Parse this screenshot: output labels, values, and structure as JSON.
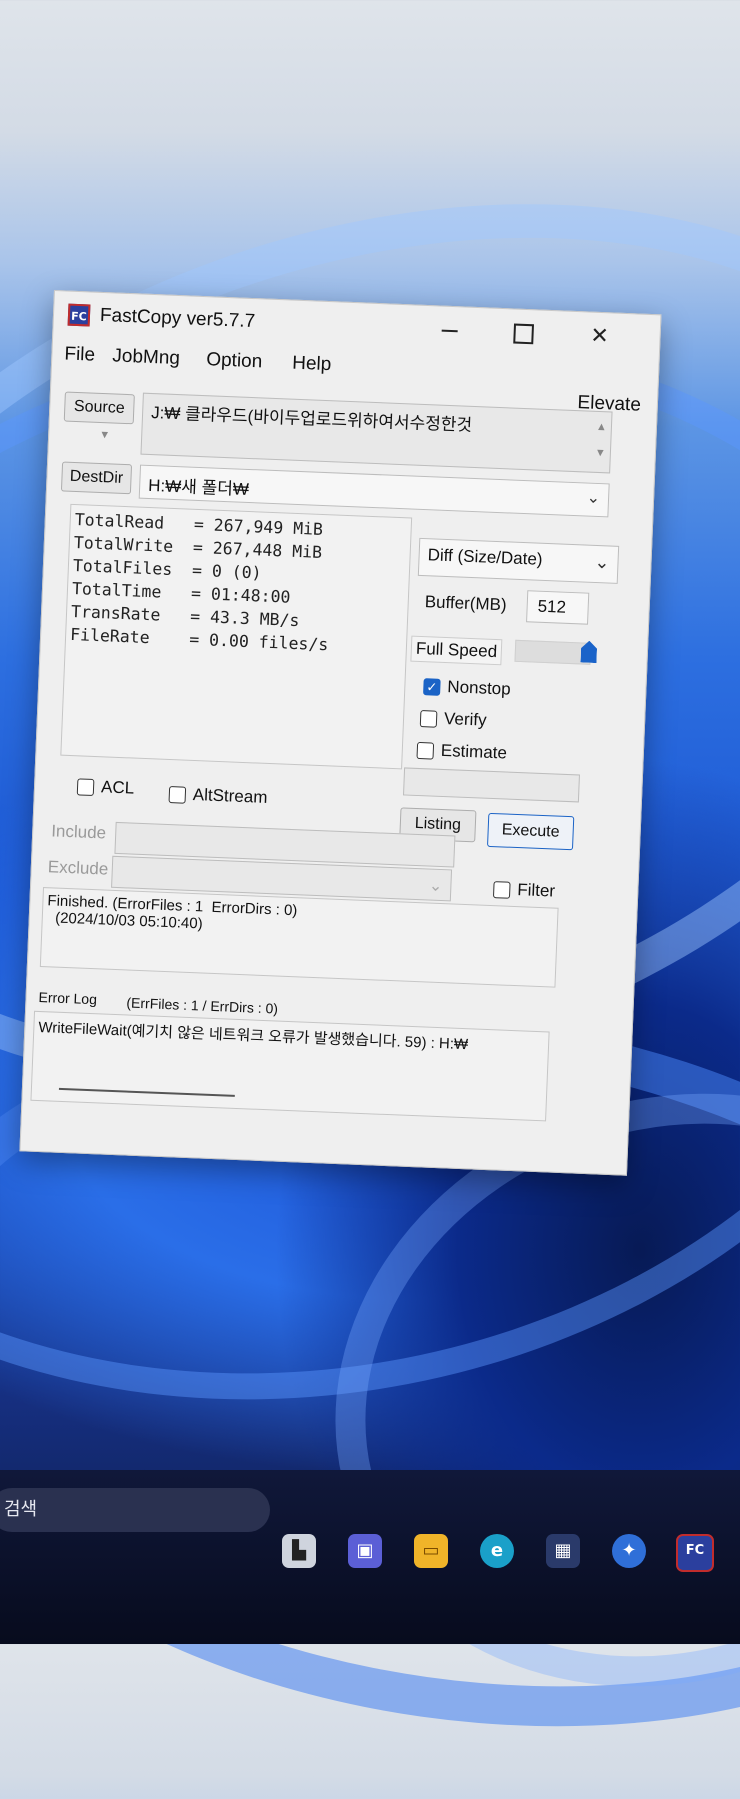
{
  "window": {
    "title": "FastCopy ver5.7.7",
    "icon_text": "FC",
    "buttons": {
      "minimize": "",
      "maximize": "",
      "close": "✕"
    }
  },
  "menu": [
    "File",
    "JobMng",
    "Option",
    "Help"
  ],
  "elevate": "Elevate",
  "source": {
    "button_label": "Source",
    "path": "J:₩        클라우드(바이두업로드위하여서수정한것"
  },
  "dest": {
    "button_label": "DestDir",
    "path": "H:₩새 폴더₩"
  },
  "stats": [
    "TotalRead   = 267,949 MiB",
    "TotalWrite  = 267,448 MiB",
    "TotalFiles  = 0 (0)",
    "TotalTime   = 01:48:00",
    "TransRate   = 43.3 MB/s",
    "FileRate    = 0.00 files/s"
  ],
  "mode": {
    "selected": "Diff (Size/Date)"
  },
  "buffer": {
    "label": "Buffer(MB)",
    "value": "512"
  },
  "speed": {
    "label": "Full Speed",
    "level": 1.0
  },
  "options": {
    "nonstop": {
      "label": "Nonstop",
      "checked": true
    },
    "verify": {
      "label": "Verify",
      "checked": false
    },
    "estimate": {
      "label": "Estimate",
      "checked": false
    },
    "acl": {
      "label": "ACL",
      "checked": false
    },
    "altstream": {
      "label": "AltStream",
      "checked": false
    },
    "filter": {
      "label": "Filter",
      "checked": false
    }
  },
  "actions": {
    "listing": "Listing",
    "execute": "Execute"
  },
  "filters": {
    "include_label": "Include",
    "exclude_label": "Exclude"
  },
  "status": {
    "line1": "Finished. (ErrorFiles : 1  ErrorDirs : 0)",
    "line2": "  (2024/10/03 05:10:40)"
  },
  "error_log": {
    "label": "Error Log",
    "counts": "(ErrFiles : 1 / ErrDirs : 0)",
    "message": "WriteFileWait(예기치 않은 네트워크 오류가 발생했습니다. 59) : H:₩"
  },
  "taskbar": {
    "search_placeholder": "검색",
    "fc_icon_text": "FC"
  },
  "colors": {
    "accent": "#1b63c6",
    "window_bg": "#efefef"
  }
}
